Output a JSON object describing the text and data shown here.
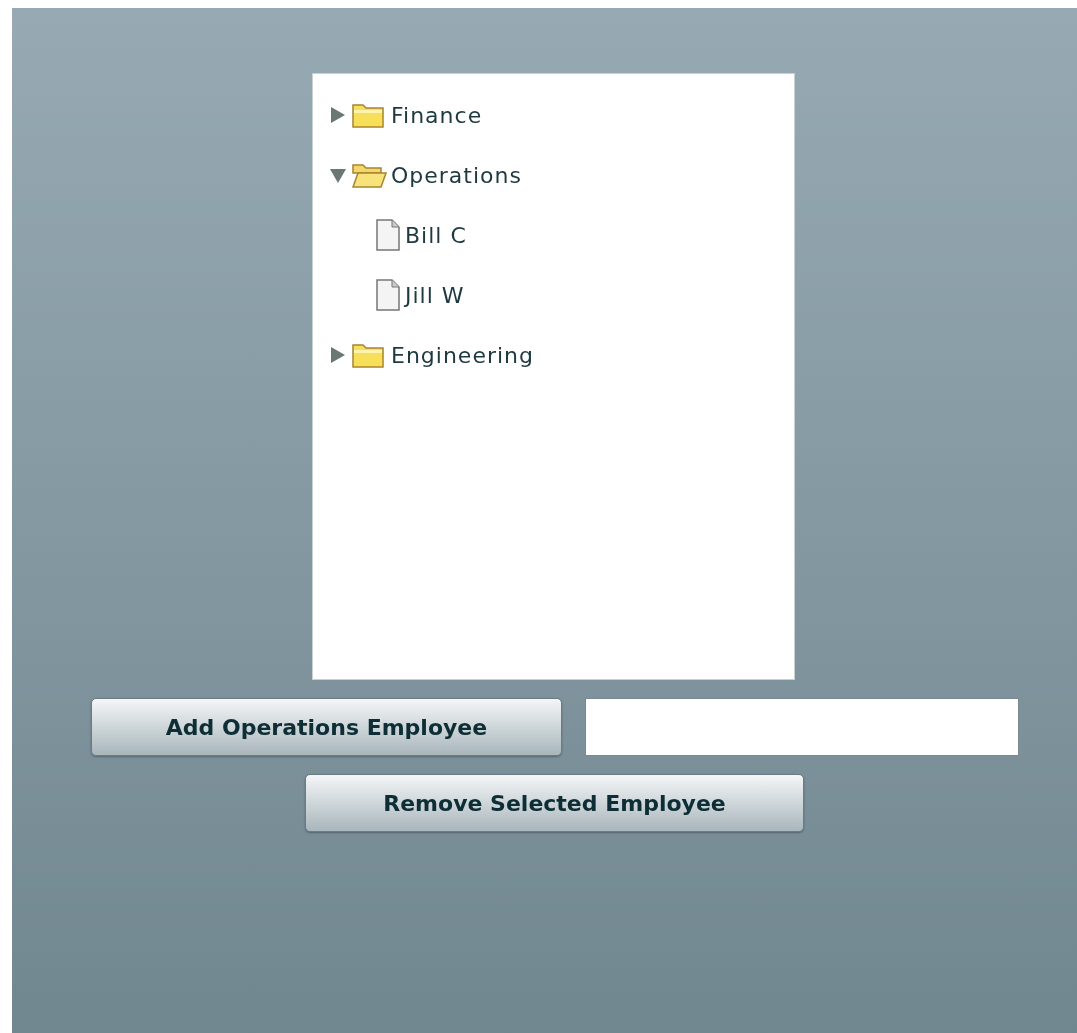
{
  "tree": [
    {
      "label": "Finance",
      "kind": "folder",
      "expanded": false
    },
    {
      "label": "Operations",
      "kind": "folder",
      "expanded": true,
      "children": [
        {
          "label": "Bill C",
          "kind": "leaf"
        },
        {
          "label": "Jill W",
          "kind": "leaf"
        }
      ]
    },
    {
      "label": "Engineering",
      "kind": "folder",
      "expanded": false
    }
  ],
  "add_button": "Add Operations Employee",
  "remove_button": "Remove Selected Employee"
}
